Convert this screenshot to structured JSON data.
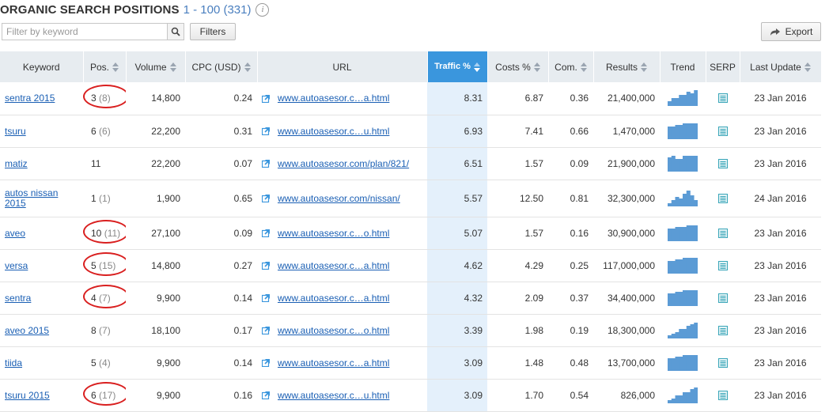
{
  "header": {
    "title": "ORGANIC SEARCH POSITIONS",
    "range": "1 - 100 (331)",
    "info": "i"
  },
  "toolbar": {
    "search_placeholder": "Filter by keyword",
    "filters_label": "Filters",
    "export_label": "Export"
  },
  "columns": [
    "Keyword",
    "Pos.",
    "Volume",
    "CPC (USD)",
    "URL",
    "Traffic %",
    "Costs %",
    "Com.",
    "Results",
    "Trend",
    "SERP",
    "Last Update"
  ],
  "colors": {
    "accent": "#3a96dd",
    "link": "#1a5fb4",
    "trend": "#5b9bd5",
    "highlight_circle": "#d91f1f"
  },
  "rows": [
    {
      "keyword": "sentra 2015",
      "pos": "3",
      "prev": "(8)",
      "circled": true,
      "volume": "14,800",
      "cpc": "0.24",
      "url": "www.autoasesor.c…a.html",
      "traffic": "8.31",
      "costs": "6.87",
      "com": "0.36",
      "results": "21,400,000",
      "trend": [
        0.3,
        0.5,
        0.5,
        0.7,
        0.7,
        0.9,
        0.8,
        1.0
      ],
      "update": "23 Jan 2016"
    },
    {
      "keyword": "tsuru",
      "pos": "6",
      "prev": "(6)",
      "circled": false,
      "volume": "22,200",
      "cpc": "0.31",
      "url": "www.autoasesor.c…u.html",
      "traffic": "6.93",
      "costs": "7.41",
      "com": "0.66",
      "results": "1,470,000",
      "trend": [
        0.8,
        0.8,
        0.9,
        0.9,
        1.0,
        1.0,
        1.0,
        1.0
      ],
      "update": "23 Jan 2016"
    },
    {
      "keyword": "matiz",
      "pos": "11",
      "prev": "",
      "circled": false,
      "volume": "22,200",
      "cpc": "0.07",
      "url": "www.autoasesor.com/plan/821/",
      "traffic": "6.51",
      "costs": "1.57",
      "com": "0.09",
      "results": "21,900,000",
      "trend": [
        0.9,
        1.0,
        0.8,
        0.8,
        1.0,
        1.0,
        1.0,
        1.0
      ],
      "update": "23 Jan 2016"
    },
    {
      "keyword": "autos nissan 2015",
      "pos": "1",
      "prev": "(1)",
      "circled": false,
      "volume": "1,900",
      "cpc": "0.65",
      "url": "www.autoasesor.com/nissan/",
      "traffic": "5.57",
      "costs": "12.50",
      "com": "0.81",
      "results": "32,300,000",
      "trend": [
        0.2,
        0.4,
        0.6,
        0.5,
        0.8,
        1.0,
        0.7,
        0.4
      ],
      "update": "24 Jan 2016"
    },
    {
      "keyword": "aveo",
      "pos": "10",
      "prev": "(11)",
      "circled": true,
      "volume": "27,100",
      "cpc": "0.09",
      "url": "www.autoasesor.c…o.html",
      "traffic": "5.07",
      "costs": "1.57",
      "com": "0.16",
      "results": "30,900,000",
      "trend": [
        0.8,
        0.8,
        0.9,
        0.9,
        0.9,
        1.0,
        1.0,
        1.0
      ],
      "update": "23 Jan 2016"
    },
    {
      "keyword": "versa",
      "pos": "5",
      "prev": "(15)",
      "circled": true,
      "volume": "14,800",
      "cpc": "0.27",
      "url": "www.autoasesor.c…a.html",
      "traffic": "4.62",
      "costs": "4.29",
      "com": "0.25",
      "results": "117,000,000",
      "trend": [
        0.8,
        0.8,
        0.9,
        0.9,
        1.0,
        1.0,
        1.0,
        1.0
      ],
      "update": "23 Jan 2016"
    },
    {
      "keyword": "sentra",
      "pos": "4",
      "prev": "(7)",
      "circled": true,
      "volume": "9,900",
      "cpc": "0.14",
      "url": "www.autoasesor.c…a.html",
      "traffic": "4.32",
      "costs": "2.09",
      "com": "0.37",
      "results": "34,400,000",
      "trend": [
        0.8,
        0.8,
        0.9,
        0.9,
        1.0,
        1.0,
        1.0,
        1.0
      ],
      "update": "23 Jan 2016"
    },
    {
      "keyword": "aveo 2015",
      "pos": "8",
      "prev": "(7)",
      "circled": false,
      "volume": "18,100",
      "cpc": "0.17",
      "url": "www.autoasesor.c…o.html",
      "traffic": "3.39",
      "costs": "1.98",
      "com": "0.19",
      "results": "18,300,000",
      "trend": [
        0.2,
        0.3,
        0.4,
        0.6,
        0.6,
        0.8,
        0.9,
        1.0
      ],
      "update": "23 Jan 2016"
    },
    {
      "keyword": "tiida",
      "pos": "5",
      "prev": "(4)",
      "circled": false,
      "volume": "9,900",
      "cpc": "0.14",
      "url": "www.autoasesor.c…a.html",
      "traffic": "3.09",
      "costs": "1.48",
      "com": "0.48",
      "results": "13,700,000",
      "trend": [
        0.8,
        0.8,
        0.9,
        0.9,
        1.0,
        1.0,
        1.0,
        1.0
      ],
      "update": "23 Jan 2016"
    },
    {
      "keyword": "tsuru 2015",
      "pos": "6",
      "prev": "(17)",
      "circled": true,
      "volume": "9,900",
      "cpc": "0.16",
      "url": "www.autoasesor.c…u.html",
      "traffic": "3.09",
      "costs": "1.70",
      "com": "0.54",
      "results": "826,000",
      "trend": [
        0.2,
        0.3,
        0.5,
        0.5,
        0.7,
        0.7,
        0.9,
        1.0
      ],
      "update": "23 Jan 2016"
    }
  ]
}
